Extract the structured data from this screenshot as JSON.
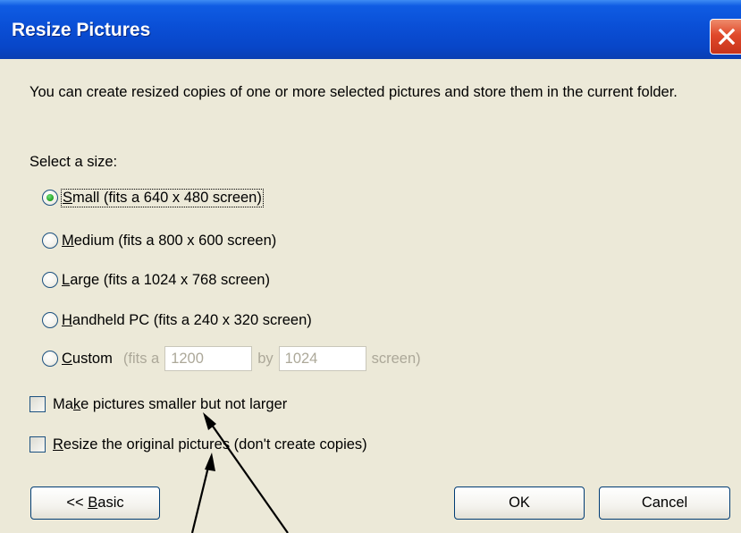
{
  "dialog": {
    "title": "Resize Pictures",
    "description": "You can create resized copies of one or more selected pictures and store them in the current folder.",
    "select_size_label": "Select a size:",
    "size_options": [
      {
        "accel": "S",
        "rest": "mall (fits a 640 x 480 screen)",
        "checked": true
      },
      {
        "accel": "M",
        "rest": "edium (fits a 800 x 600 screen)",
        "checked": false
      },
      {
        "accel": "L",
        "rest": "arge (fits a 1024 x 768 screen)",
        "checked": false
      },
      {
        "accel": "H",
        "rest": "andheld PC (fits a 240 x 320 screen)",
        "checked": false
      }
    ],
    "custom": {
      "accel": "C",
      "rest": "ustom",
      "fits_prefix": "(fits a",
      "width_value": "1200",
      "by_label": "by",
      "height_value": "1024",
      "suffix": "screen)",
      "checked": false
    },
    "checkboxes": [
      {
        "pre": "Ma",
        "accel": "k",
        "post": "e pictures smaller but not larger",
        "checked": false
      },
      {
        "pre": "",
        "accel": "R",
        "post": "esize the original pictures (don't create copies)",
        "checked": false
      }
    ],
    "buttons": {
      "basic_pre": "<< ",
      "basic_accel": "B",
      "basic_post": "asic",
      "ok": "OK",
      "cancel": "Cancel"
    }
  },
  "colors": {
    "titlebar": "#0a4fd6",
    "dialog_bg": "#ece9d8",
    "close_red": "#e0492a",
    "disabled_text": "#aca899"
  }
}
